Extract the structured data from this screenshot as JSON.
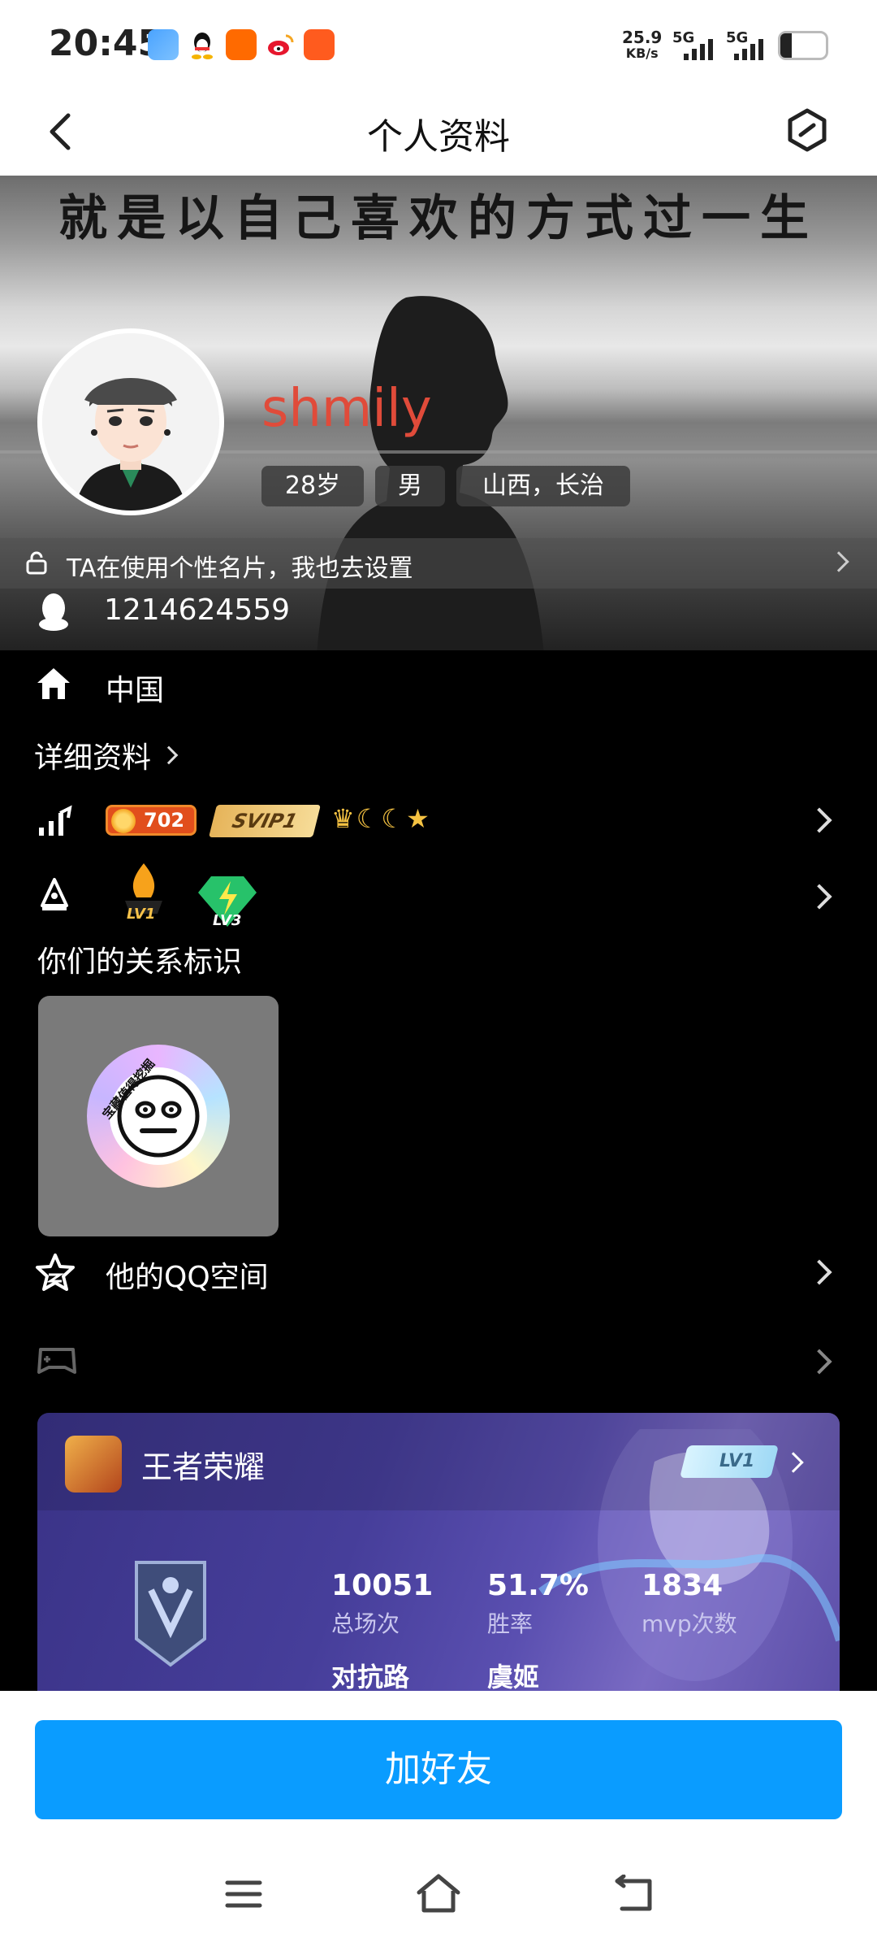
{
  "status": {
    "time": "20:45",
    "net_speed_value": "25.9",
    "net_speed_unit": "KB/s",
    "sim1": "5G",
    "sim2": "5G"
  },
  "header": {
    "title": "个人资料"
  },
  "cover": {
    "motto": "就是以自己喜欢的方式过一生"
  },
  "profile": {
    "name": "shmily",
    "age": "28岁",
    "gender": "男",
    "location": "山西，长治",
    "promo": "TA在使用个性名片，我也去设置",
    "qq_number": "1214624559",
    "hometown": "中国",
    "detail_link": "详细资料"
  },
  "badges": {
    "level_value": "702",
    "svip": "SVIP1",
    "medal1": "LV1",
    "medal2": "LV3"
  },
  "relationship": {
    "heading": "你们的关系标识",
    "disc_text": "宝藏值得挖掘"
  },
  "qzone": {
    "label": "他的QQ空间"
  },
  "game": {
    "name": "王者荣耀",
    "level": "LV1",
    "stats": [
      {
        "value": "10051",
        "label": "总场次"
      },
      {
        "value": "51.7%",
        "label": "胜率"
      },
      {
        "value": "1834",
        "label": "mvp次数"
      }
    ],
    "lane": "对抗路",
    "hero": "虞姬"
  },
  "action": {
    "add_friend": "加好友"
  },
  "colors": {
    "accent_blue": "#0a9cff",
    "name_red": "#e04b3a"
  }
}
